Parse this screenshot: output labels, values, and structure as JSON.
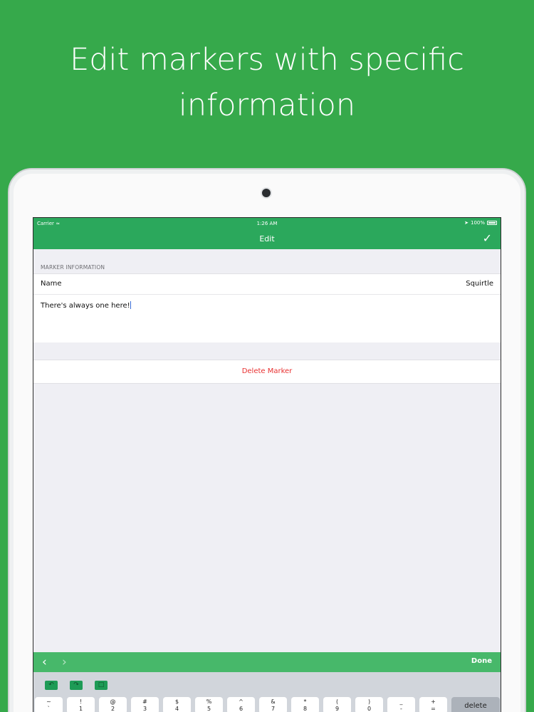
{
  "headline": {
    "line1": "Edit markers with specific",
    "line2": "information"
  },
  "status_bar": {
    "carrier": "Carrier",
    "time": "1:26 AM",
    "battery": "100%"
  },
  "nav": {
    "title": "Edit",
    "confirm_icon": "checkmark-icon"
  },
  "section": {
    "header": "MARKER INFORMATION"
  },
  "name_row": {
    "label": "Name",
    "value": "Squirtle"
  },
  "notes": {
    "text": "There's always one here!"
  },
  "delete_row": {
    "label": "Delete Marker"
  },
  "keyboard_toolbar": {
    "prev_icon": "chevron-left-icon",
    "next_icon": "chevron-right-icon",
    "done": "Done"
  },
  "keyboard": {
    "tools": [
      "undo-icon",
      "redo-icon",
      "paste-icon"
    ],
    "keys": [
      {
        "top": "~",
        "bottom": "`"
      },
      {
        "top": "!",
        "bottom": "1"
      },
      {
        "top": "@",
        "bottom": "2"
      },
      {
        "top": "#",
        "bottom": "3"
      },
      {
        "top": "$",
        "bottom": "4"
      },
      {
        "top": "%",
        "bottom": "5"
      },
      {
        "top": "^",
        "bottom": "6"
      },
      {
        "top": "&",
        "bottom": "7"
      },
      {
        "top": "*",
        "bottom": "8"
      },
      {
        "top": "(",
        "bottom": "9"
      },
      {
        "top": ")",
        "bottom": "0"
      },
      {
        "top": "_",
        "bottom": "-"
      },
      {
        "top": "+",
        "bottom": "="
      }
    ],
    "delete": "delete"
  },
  "colors": {
    "background": "#36a94b",
    "nav": "#2ba85c",
    "toolbar": "#47b86a",
    "destructive": "#e83030"
  }
}
